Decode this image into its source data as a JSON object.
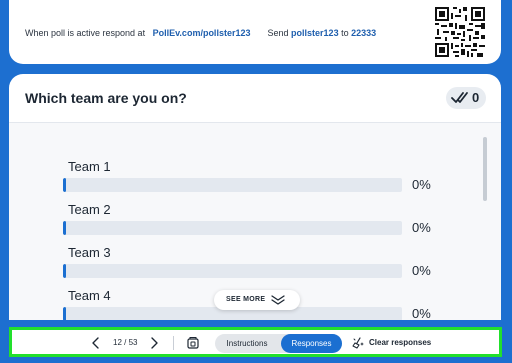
{
  "respond_bar": {
    "prefix": "When poll is active respond at",
    "url": "PollEv.com/pollster123",
    "send_text": "Send",
    "keyword": "pollster123",
    "to_text": "to",
    "number": "22333",
    "qr_icon": "qr-code"
  },
  "poll": {
    "title": "Which team are you on?",
    "responses_icon": "check-marks-icon",
    "response_count": "0",
    "options": [
      {
        "label": "Team 1",
        "percent_text": "0%",
        "value": 0
      },
      {
        "label": "Team 2",
        "percent_text": "0%",
        "value": 0
      },
      {
        "label": "Team 3",
        "percent_text": "0%",
        "value": 0
      },
      {
        "label": "Team 4",
        "percent_text": "0%",
        "value": 0
      }
    ],
    "see_more_label": "SEE MORE"
  },
  "toolbar": {
    "slide_counter": "12 / 53",
    "instructions_label": "Instructions",
    "responses_label": "Responses",
    "clear_label": "Clear responses",
    "accent": "#1b6fd1",
    "highlight_border": "#22e02c"
  }
}
